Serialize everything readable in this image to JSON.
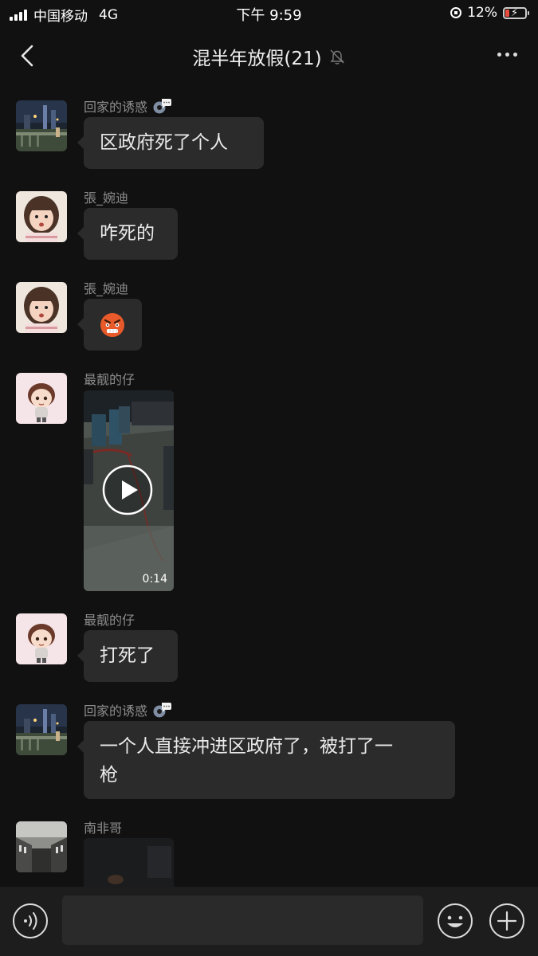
{
  "status_bar": {
    "carrier": "中国移动",
    "network": "4G",
    "time": "下午 9:59",
    "battery": "12%",
    "battery_level": 0.12
  },
  "header": {
    "title": "混半年放假(21)",
    "back_icon": "chevron-left-icon",
    "mute_icon": "bell-slash-icon",
    "more_icon": "ellipsis-icon"
  },
  "messages": [
    {
      "sender": "回家的诱惑",
      "text": "区政府死了个人"
    },
    {
      "sender": "張_婉迪",
      "text": "咋死的"
    },
    {
      "sender": "張_婉迪",
      "sticker": "angry-face-emoji"
    },
    {
      "sender": "最靓的仔",
      "video_duration": "0:14"
    },
    {
      "sender": "最靓的仔",
      "text": "打死了"
    },
    {
      "sender": "回家的诱惑",
      "text_line1": "一个人直接冲进区政府了，被打了一",
      "text_line2": "枪"
    },
    {
      "sender": "南非哥"
    }
  ],
  "bottom_bar": {
    "voice_icon": "voice-icon",
    "emoji_icon": "smiley-icon",
    "plus_icon": "plus-circle-icon"
  },
  "colors": {
    "background": "#111111",
    "bubble": "#2b2b2b",
    "sender_text": "#8c8c8c",
    "battery_low": "#e84c3d"
  }
}
